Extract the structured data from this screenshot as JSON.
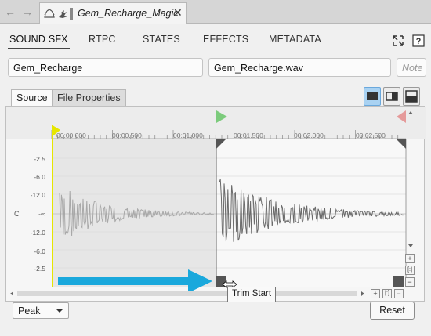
{
  "document_tab": {
    "title": "Gem_Recharge_Magic",
    "close": "✕"
  },
  "nav": {
    "back": "←",
    "forward": "→"
  },
  "main_tabs": [
    {
      "label": "SOUND SFX",
      "active": true
    },
    {
      "label": "RTPC"
    },
    {
      "label": "STATES"
    },
    {
      "label": "EFFECTS"
    },
    {
      "label": "METADATA"
    }
  ],
  "fields": {
    "name": "Gem_Recharge",
    "file": "Gem_Recharge.wav",
    "notes_placeholder": "Note"
  },
  "sub_tabs": [
    {
      "label": "Source",
      "active": true
    },
    {
      "label": "File Properties"
    }
  ],
  "timeline": {
    "ticks": [
      "00:00.000",
      "00:00.500",
      "00:01.000",
      "00:01.500",
      "00:02.000",
      "00:02.500"
    ]
  },
  "db_scale": {
    "top": [
      "-2.5",
      "-6.0",
      "-12.0",
      "-∞",
      "-12.0",
      "-6.0",
      "-2.5"
    ],
    "channel": "C"
  },
  "tooltip": "Trim Start",
  "meter_mode": "Peak",
  "reset_label": "Reset",
  "scroll_buttons": {
    "plus": "+",
    "fit": "[:]",
    "minus": "−"
  },
  "colors": {
    "accent_arrow": "#1aa8dc",
    "trim_start_marker": "#e6e600",
    "play_marker": "#78c878",
    "end_marker": "#e08a8a"
  }
}
